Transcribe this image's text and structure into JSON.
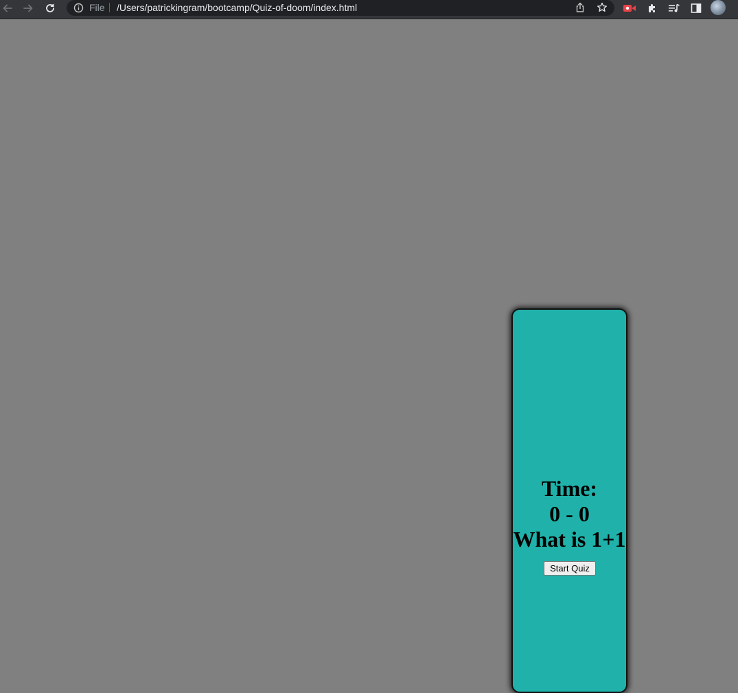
{
  "browser": {
    "address_bar": {
      "scheme_label": "File",
      "url": "/Users/patrickingram/bootcamp/Quiz-of-doom/index.html"
    },
    "toolbar_icons": [
      "back-arrow-icon",
      "forward-arrow-icon",
      "reload-icon",
      "site-info-icon",
      "share-icon",
      "bookmark-star-icon",
      "extension-red-icon",
      "extensions-puzzle-icon",
      "media-playlist-icon",
      "side-panel-icon",
      "profile-avatar"
    ]
  },
  "page": {
    "background_color": "#808080",
    "card_color": "#20b2aa",
    "quiz": {
      "time_label": "Time:",
      "score": "0 - 0",
      "question": "What is 1+1",
      "start_button_label": "Start Quiz"
    }
  }
}
